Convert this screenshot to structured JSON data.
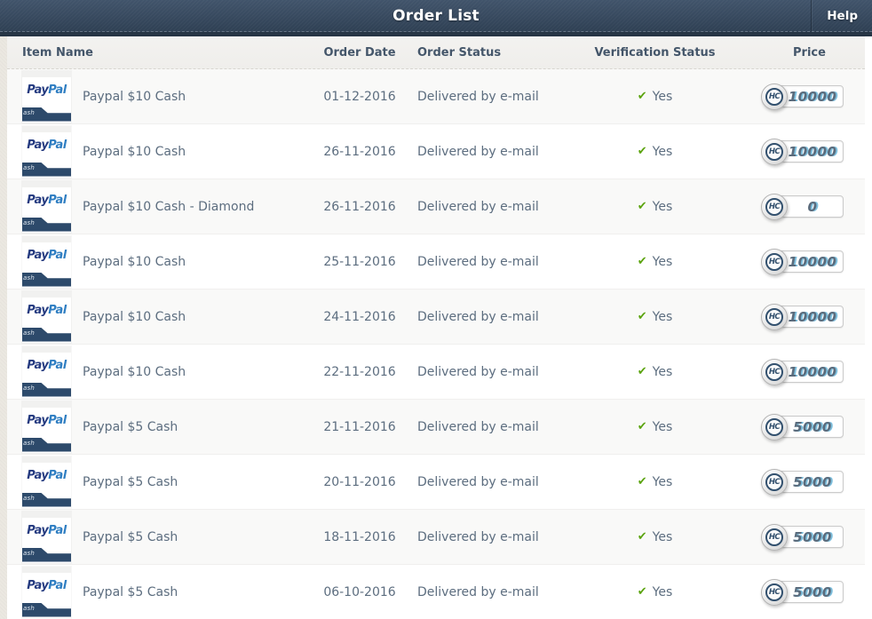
{
  "header": {
    "title": "Order List",
    "help_label": "Help"
  },
  "table": {
    "columns": [
      "Item Name",
      "Order Date",
      "Order Status",
      "Verification Status",
      "Price"
    ],
    "thumbnail": {
      "brand_pay": "Pay",
      "brand_pal": "Pal",
      "ribbon_text": "ash"
    },
    "check_glyph": "✔",
    "coin_label": "HC",
    "rows": [
      {
        "item": "Paypal $10 Cash",
        "date": "01-12-2016",
        "status": "Delivered by e-mail",
        "verified": "Yes",
        "price": "10000"
      },
      {
        "item": "Paypal $10 Cash",
        "date": "26-11-2016",
        "status": "Delivered by e-mail",
        "verified": "Yes",
        "price": "10000"
      },
      {
        "item": "Paypal $10 Cash - Diamond",
        "date": "26-11-2016",
        "status": "Delivered by e-mail",
        "verified": "Yes",
        "price": "0"
      },
      {
        "item": "Paypal $10 Cash",
        "date": "25-11-2016",
        "status": "Delivered by e-mail",
        "verified": "Yes",
        "price": "10000"
      },
      {
        "item": "Paypal $10 Cash",
        "date": "24-11-2016",
        "status": "Delivered by e-mail",
        "verified": "Yes",
        "price": "10000"
      },
      {
        "item": "Paypal $10 Cash",
        "date": "22-11-2016",
        "status": "Delivered by e-mail",
        "verified": "Yes",
        "price": "10000"
      },
      {
        "item": "Paypal $5 Cash",
        "date": "21-11-2016",
        "status": "Delivered by e-mail",
        "verified": "Yes",
        "price": "5000"
      },
      {
        "item": "Paypal $5 Cash",
        "date": "20-11-2016",
        "status": "Delivered by e-mail",
        "verified": "Yes",
        "price": "5000"
      },
      {
        "item": "Paypal $5 Cash",
        "date": "18-11-2016",
        "status": "Delivered by e-mail",
        "verified": "Yes",
        "price": "5000"
      },
      {
        "item": "Paypal $5 Cash",
        "date": "06-10-2016",
        "status": "Delivered by e-mail",
        "verified": "Yes",
        "price": "5000"
      }
    ]
  },
  "colors": {
    "header_navy": "#31445a",
    "ribbon_navy": "#2d4a6b",
    "check_green": "#5aa30d",
    "price_text": "#5a6b7c",
    "price_highlight": "#7fc0de"
  }
}
